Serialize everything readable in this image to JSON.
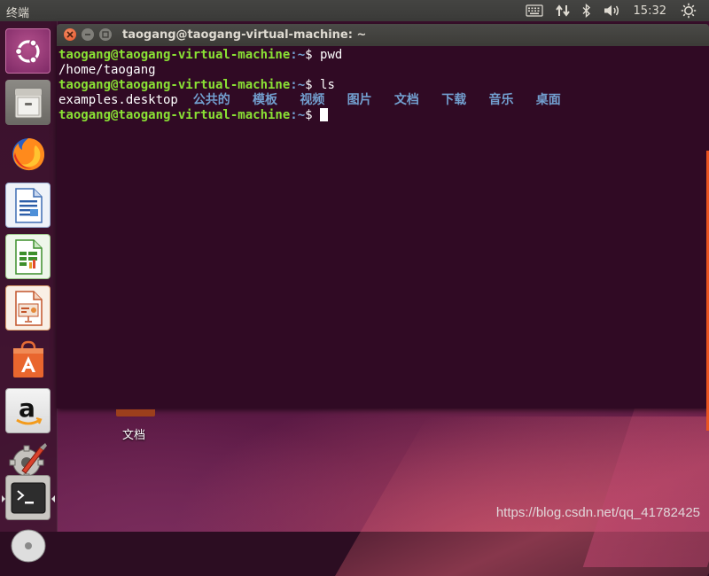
{
  "topbar": {
    "app_title": "终端",
    "clock": "15:32",
    "indicators": [
      "keyboard-icon",
      "network-icon",
      "bluetooth-icon",
      "volume-icon",
      "power-gear-icon"
    ]
  },
  "launcher": {
    "items": [
      {
        "name": "dash-home",
        "icon": "ubuntu-logo-icon"
      },
      {
        "name": "files",
        "icon": "file-cabinet-icon"
      },
      {
        "name": "firefox",
        "icon": "firefox-icon"
      },
      {
        "name": "writer",
        "icon": "libreoffice-writer-icon"
      },
      {
        "name": "calc",
        "icon": "libreoffice-calc-icon"
      },
      {
        "name": "impress",
        "icon": "libreoffice-impress-icon"
      },
      {
        "name": "software",
        "icon": "ubuntu-software-icon"
      },
      {
        "name": "amazon",
        "icon": "amazon-icon"
      },
      {
        "name": "settings",
        "icon": "system-settings-icon"
      },
      {
        "name": "terminal",
        "icon": "terminal-icon",
        "active": true
      },
      {
        "name": "dvd",
        "icon": "dvd-icon"
      }
    ]
  },
  "window": {
    "title": "taogang@taogang-virtual-machine: ~"
  },
  "terminal": {
    "prompt_user": "taogang@taogang-virtual-machine",
    "prompt_path": ":~",
    "prompt_symbol": "$",
    "cmd1": " pwd",
    "out1": "/home/taogang",
    "cmd2": " ls",
    "ls_file": "examples.desktop",
    "ls_dirs": [
      "公共的",
      "模板",
      "视频",
      "图片",
      "文档",
      "下载",
      "音乐",
      "桌面"
    ]
  },
  "desktop": {
    "icon_label": "文档"
  },
  "watermark": "https://blog.csdn.net/qq_41782425",
  "colors": {
    "terminal_bg": "#300a24",
    "prompt_green": "#8ae234",
    "dir_blue": "#729fcf",
    "ubuntu_orange": "#e95420"
  }
}
